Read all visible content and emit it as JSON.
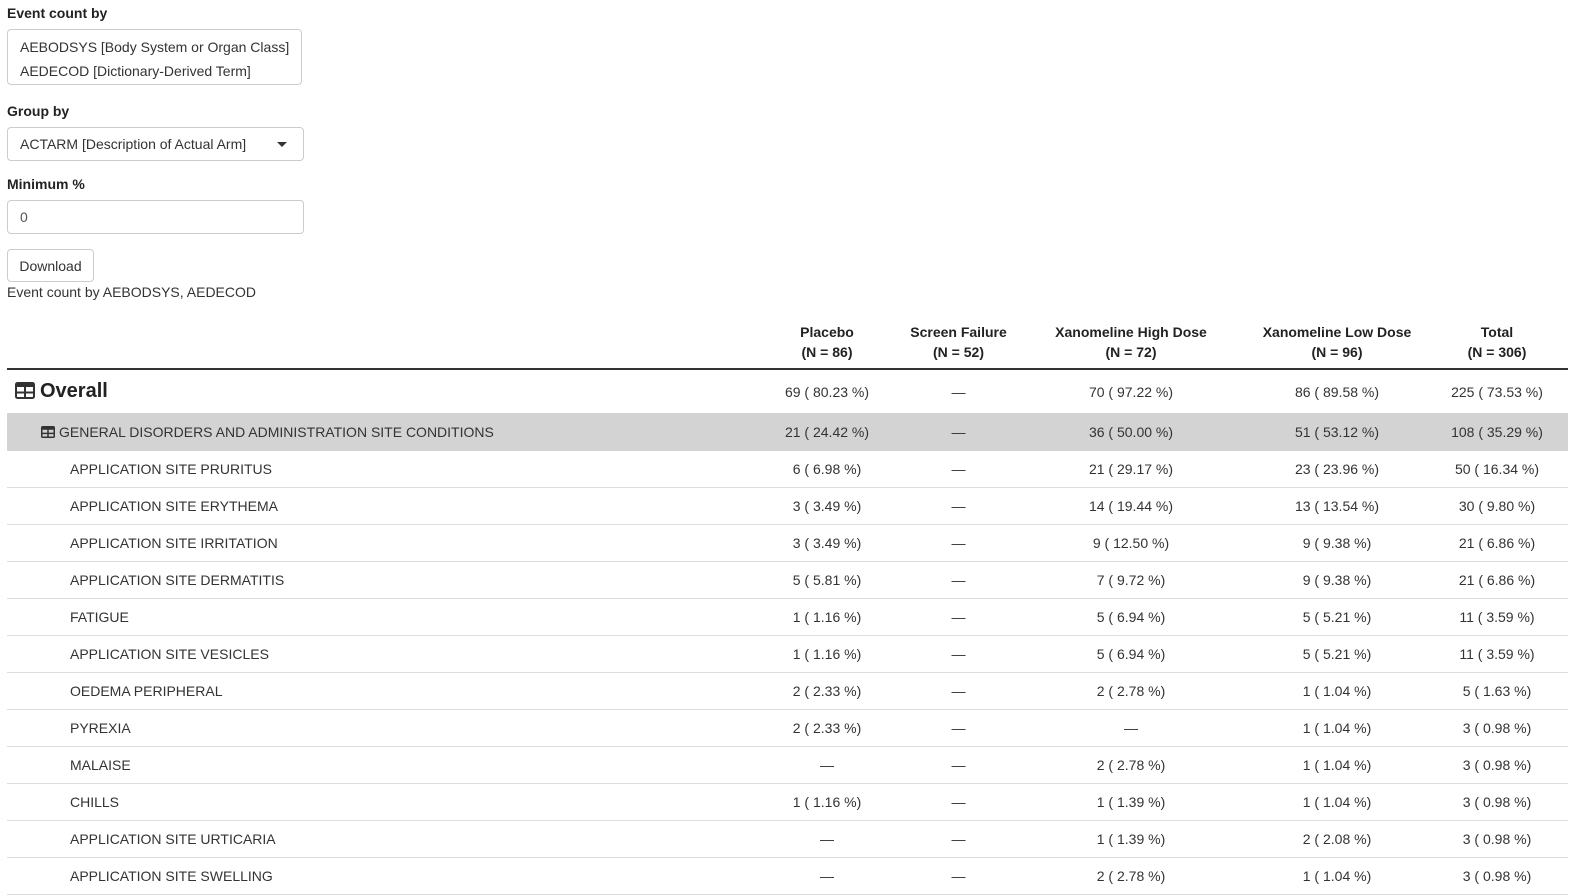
{
  "controls": {
    "event_count_label": "Event count by",
    "event_count_options": [
      "AEBODSYS [Body System or Organ Class]",
      "AEDECOD [Dictionary-Derived Term]"
    ],
    "group_by_label": "Group by",
    "group_by_value": "ACTARM [Description of Actual Arm]",
    "min_pct_label": "Minimum %",
    "min_pct_value": "0",
    "download_label": "Download"
  },
  "caption": "Event count by AEBODSYS, AEDECOD",
  "table": {
    "columns": [
      {
        "name": "Placebo",
        "n": "(N = 86)"
      },
      {
        "name": "Screen Failure",
        "n": "(N = 52)"
      },
      {
        "name": "Xanomeline High Dose",
        "n": "(N = 72)"
      },
      {
        "name": "Xanomeline Low Dose",
        "n": "(N = 96)"
      },
      {
        "name": "Total",
        "n": "(N = 306)"
      }
    ],
    "overall": {
      "label": "Overall",
      "icon": "table-icon",
      "values": [
        "69 ( 80.23 %)",
        "—",
        "70 ( 97.22 %)",
        "86 ( 89.58 %)",
        "225 ( 73.53 %)"
      ]
    },
    "group": {
      "label": "GENERAL DISORDERS AND ADMINISTRATION SITE CONDITIONS",
      "icon": "table-icon",
      "values": [
        "21 ( 24.42 %)",
        "—",
        "36 ( 50.00 %)",
        "51 ( 53.12 %)",
        "108 ( 35.29 %)"
      ]
    },
    "rows": [
      {
        "label": "APPLICATION SITE PRURITUS",
        "values": [
          "6 ( 6.98 %)",
          "—",
          "21 ( 29.17 %)",
          "23 ( 23.96 %)",
          "50 ( 16.34 %)"
        ]
      },
      {
        "label": "APPLICATION SITE ERYTHEMA",
        "values": [
          "3 ( 3.49 %)",
          "—",
          "14 ( 19.44 %)",
          "13 ( 13.54 %)",
          "30 ( 9.80 %)"
        ]
      },
      {
        "label": "APPLICATION SITE IRRITATION",
        "values": [
          "3 ( 3.49 %)",
          "—",
          "9 ( 12.50 %)",
          "9 ( 9.38 %)",
          "21 ( 6.86 %)"
        ]
      },
      {
        "label": "APPLICATION SITE DERMATITIS",
        "values": [
          "5 ( 5.81 %)",
          "—",
          "7 ( 9.72 %)",
          "9 ( 9.38 %)",
          "21 ( 6.86 %)"
        ]
      },
      {
        "label": "FATIGUE",
        "values": [
          "1 ( 1.16 %)",
          "—",
          "5 ( 6.94 %)",
          "5 ( 5.21 %)",
          "11 ( 3.59 %)"
        ]
      },
      {
        "label": "APPLICATION SITE VESICLES",
        "values": [
          "1 ( 1.16 %)",
          "—",
          "5 ( 6.94 %)",
          "5 ( 5.21 %)",
          "11 ( 3.59 %)"
        ]
      },
      {
        "label": "OEDEMA PERIPHERAL",
        "values": [
          "2 ( 2.33 %)",
          "—",
          "2 ( 2.78 %)",
          "1 ( 1.04 %)",
          "5 ( 1.63 %)"
        ]
      },
      {
        "label": "PYREXIA",
        "values": [
          "2 ( 2.33 %)",
          "—",
          "—",
          "1 ( 1.04 %)",
          "3 ( 0.98 %)"
        ]
      },
      {
        "label": "MALAISE",
        "values": [
          "—",
          "—",
          "2 ( 2.78 %)",
          "1 ( 1.04 %)",
          "3 ( 0.98 %)"
        ]
      },
      {
        "label": "CHILLS",
        "values": [
          "1 ( 1.16 %)",
          "—",
          "1 ( 1.39 %)",
          "1 ( 1.04 %)",
          "3 ( 0.98 %)"
        ]
      },
      {
        "label": "APPLICATION SITE URTICARIA",
        "values": [
          "—",
          "—",
          "1 ( 1.39 %)",
          "2 ( 2.08 %)",
          "3 ( 0.98 %)"
        ]
      },
      {
        "label": "APPLICATION SITE SWELLING",
        "values": [
          "—",
          "—",
          "2 ( 2.78 %)",
          "1 ( 1.04 %)",
          "3 ( 0.98 %)"
        ]
      }
    ]
  }
}
